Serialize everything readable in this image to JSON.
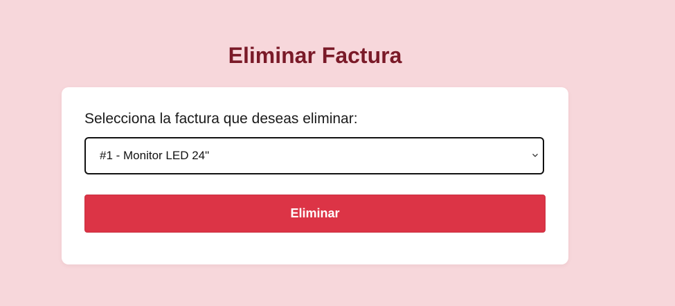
{
  "page": {
    "title": "Eliminar Factura"
  },
  "form": {
    "label": "Selecciona la factura que deseas eliminar:",
    "select": {
      "selected_value": "#1 - Monitor LED 24\"",
      "icon": "chevron-down-icon"
    },
    "submit_label": "Eliminar"
  },
  "colors": {
    "background": "#f7d7db",
    "title": "#7a1a28",
    "button": "#dc3446",
    "card": "#ffffff"
  }
}
